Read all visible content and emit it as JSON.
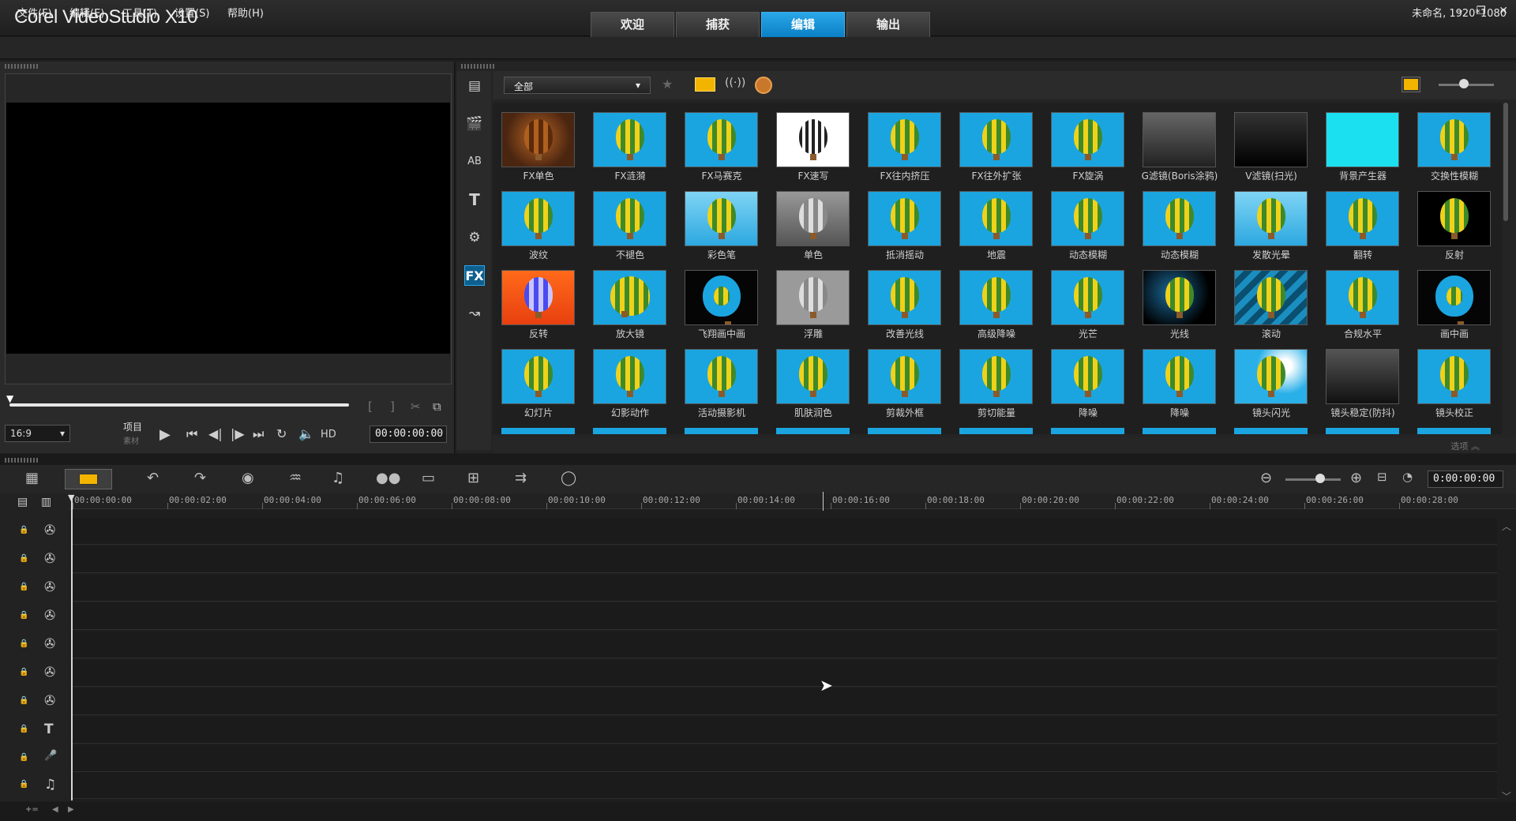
{
  "app": {
    "title": "Corel VideoStudio X10",
    "window_controls": [
      "–",
      "❐",
      "✕"
    ]
  },
  "workspace_tabs": [
    "欢迎",
    "捕获",
    "编辑",
    "输出"
  ],
  "active_tab": "编辑",
  "menu": [
    "文件(F)",
    "编辑(E)",
    "工具(T)",
    "设置(S)",
    "帮助(H)"
  ],
  "project_info": "未命名, 1920*1080",
  "preview": {
    "aspect": "16:9",
    "mode_project": "项目",
    "mode_clip": "素材",
    "hd": "HD",
    "timecode": "00:00:00:00"
  },
  "library": {
    "filter": "全部",
    "options_label": "选项",
    "items": [
      {
        "label": "FX单色",
        "style": "sepia"
      },
      {
        "label": "FX涟漪",
        "style": "balloon"
      },
      {
        "label": "FX马赛克",
        "style": "balloon"
      },
      {
        "label": "FX速写",
        "style": "sketch"
      },
      {
        "label": "FX往内挤压",
        "style": "balloon"
      },
      {
        "label": "FX往外扩张",
        "style": "balloon"
      },
      {
        "label": "FX旋涡",
        "style": "balloon"
      },
      {
        "label": "G滤镜(Boris涂鸦)",
        "style": "boris"
      },
      {
        "label": "V滤镜(扫光)",
        "style": "vlogo"
      },
      {
        "label": "背景产生器",
        "style": "cyan"
      },
      {
        "label": "交换性模糊",
        "style": "balloon"
      },
      {
        "label": "波纹",
        "style": "ripple"
      },
      {
        "label": "不褪色",
        "style": "balloon"
      },
      {
        "label": "彩色笔",
        "style": "pale"
      },
      {
        "label": "单色",
        "style": "gray"
      },
      {
        "label": "抵消摇动",
        "style": "balloon"
      },
      {
        "label": "地震",
        "style": "balloon"
      },
      {
        "label": "动态模糊",
        "style": "blur"
      },
      {
        "label": "动态模糊",
        "style": "balloon"
      },
      {
        "label": "发散光晕",
        "style": "pale"
      },
      {
        "label": "翻转",
        "style": "balloon"
      },
      {
        "label": "反射",
        "style": "reflect"
      },
      {
        "label": "反转",
        "style": "invert"
      },
      {
        "label": "放大镜",
        "style": "magnify"
      },
      {
        "label": "飞翔画中画",
        "style": "pip"
      },
      {
        "label": "浮雕",
        "style": "emboss"
      },
      {
        "label": "改善光线",
        "style": "balloon"
      },
      {
        "label": "高级降噪",
        "style": "balloon"
      },
      {
        "label": "光芒",
        "style": "flare"
      },
      {
        "label": "光线",
        "style": "dark"
      },
      {
        "label": "滚动",
        "style": "stripes"
      },
      {
        "label": "合规水平",
        "style": "balloon"
      },
      {
        "label": "画中画",
        "style": "pip"
      },
      {
        "label": "幻灯片",
        "style": "balloon"
      },
      {
        "label": "幻影动作",
        "style": "balloon"
      },
      {
        "label": "活动摄影机",
        "style": "balloon"
      },
      {
        "label": "肌肤润色",
        "style": "balloon"
      },
      {
        "label": "剪裁外框",
        "style": "balloon"
      },
      {
        "label": "剪切能量",
        "style": "balloon"
      },
      {
        "label": "降噪",
        "style": "balloon"
      },
      {
        "label": "降噪",
        "style": "balloon"
      },
      {
        "label": "镜头闪光",
        "style": "lensflare"
      },
      {
        "label": "镜头稳定(防抖)",
        "style": "mlogo"
      },
      {
        "label": "镜头校正",
        "style": "balloon"
      }
    ]
  },
  "timeline": {
    "timecode": "0:00:00:00",
    "ruler": [
      "00:00:00:00",
      "00:00:02:00",
      "00:00:04:00",
      "00:00:06:00",
      "00:00:08:00",
      "00:00:10:00",
      "00:00:12:00",
      "00:00:14:00",
      "00:00:16:00",
      "00:00:18:00",
      "00:00:20:00",
      "00:00:22:00",
      "00:00:24:00",
      "00:00:26:00",
      "00:00:28:00"
    ],
    "tracks": [
      "video",
      "overlay-1",
      "overlay-2",
      "overlay-3",
      "overlay-4",
      "overlay-5",
      "overlay-6",
      "title",
      "voice",
      "music"
    ]
  }
}
